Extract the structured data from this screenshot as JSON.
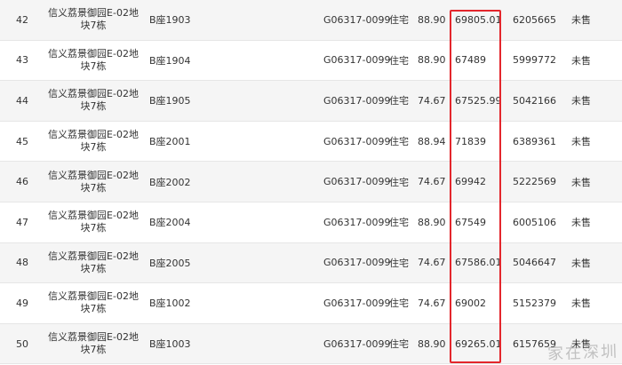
{
  "rows": [
    {
      "no": "42",
      "project": "信义荔景御园E-02地块7栋",
      "room": "B座1903",
      "code": "G06317-0099",
      "use": "住宅",
      "area": "88.90",
      "price": "69805.01",
      "total": "6205665",
      "status": "未售"
    },
    {
      "no": "43",
      "project": "信义荔景御园E-02地块7栋",
      "room": "B座1904",
      "code": "G06317-0099",
      "use": "住宅",
      "area": "88.90",
      "price": "67489",
      "total": "5999772",
      "status": "未售"
    },
    {
      "no": "44",
      "project": "信义荔景御园E-02地块7栋",
      "room": "B座1905",
      "code": "G06317-0099",
      "use": "住宅",
      "area": "74.67",
      "price": "67525.99",
      "total": "5042166",
      "status": "未售"
    },
    {
      "no": "45",
      "project": "信义荔景御园E-02地块7栋",
      "room": "B座2001",
      "code": "G06317-0099",
      "use": "住宅",
      "area": "88.94",
      "price": "71839",
      "total": "6389361",
      "status": "未售"
    },
    {
      "no": "46",
      "project": "信义荔景御园E-02地块7栋",
      "room": "B座2002",
      "code": "G06317-0099",
      "use": "住宅",
      "area": "74.67",
      "price": "69942",
      "total": "5222569",
      "status": "未售"
    },
    {
      "no": "47",
      "project": "信义荔景御园E-02地块7栋",
      "room": "B座2004",
      "code": "G06317-0099",
      "use": "住宅",
      "area": "88.90",
      "price": "67549",
      "total": "6005106",
      "status": "未售"
    },
    {
      "no": "48",
      "project": "信义荔景御园E-02地块7栋",
      "room": "B座2005",
      "code": "G06317-0099",
      "use": "住宅",
      "area": "74.67",
      "price": "67586.01",
      "total": "5046647",
      "status": "未售"
    },
    {
      "no": "49",
      "project": "信义荔景御园E-02地块7栋",
      "room": "B座1002",
      "code": "G06317-0099",
      "use": "住宅",
      "area": "74.67",
      "price": "69002",
      "total": "5152379",
      "status": "未售"
    },
    {
      "no": "50",
      "project": "信义荔景御园E-02地块7栋",
      "room": "B座1003",
      "code": "G06317-0099",
      "use": "住宅",
      "area": "88.90",
      "price": "69265.01",
      "total": "6157659",
      "status": "未售"
    }
  ],
  "colors": {
    "highlight_border": "#e3262c",
    "row_alt": "#f5f5f5"
  }
}
